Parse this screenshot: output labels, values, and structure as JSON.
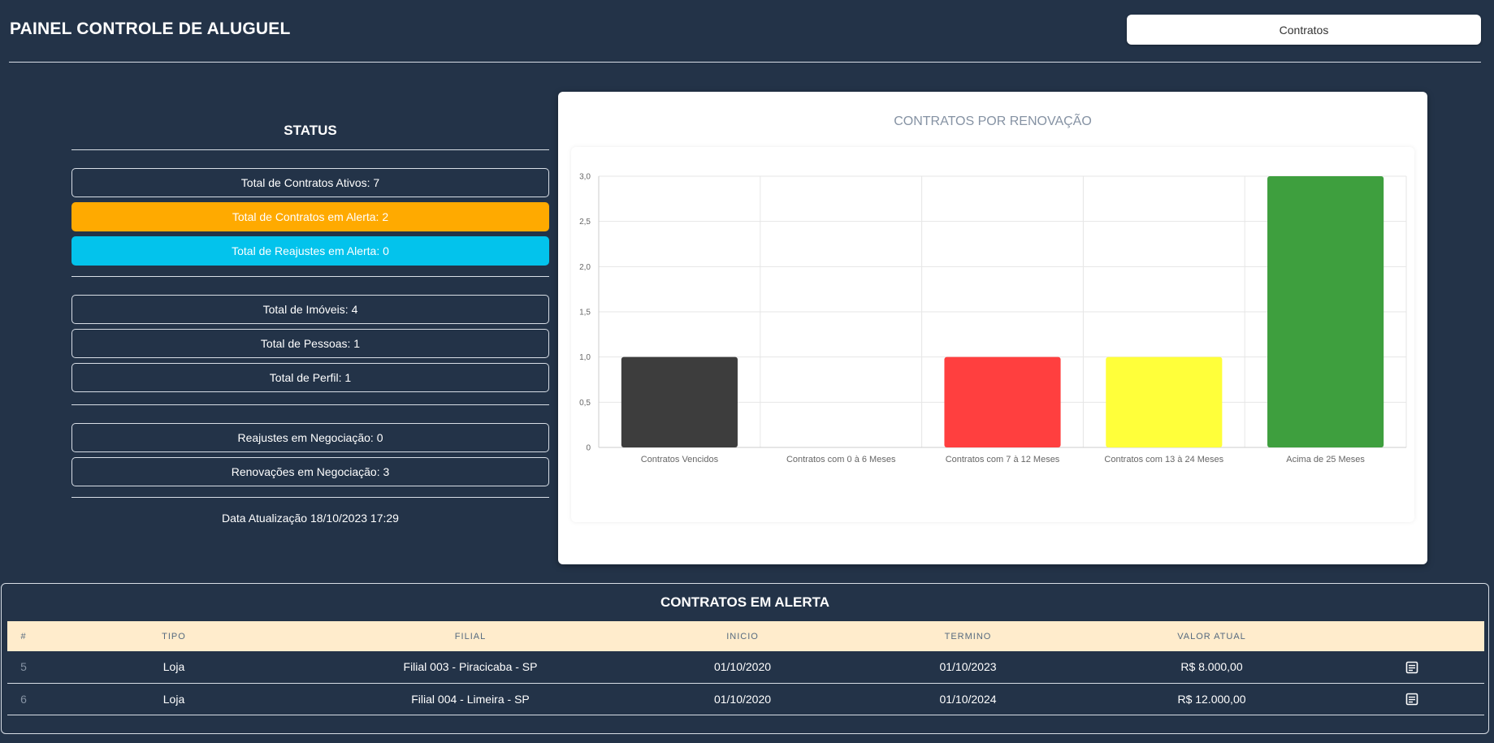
{
  "header": {
    "title": "PAINEL CONTROLE DE ALUGUEL",
    "contracts_button": "Contratos"
  },
  "status": {
    "title": "STATUS",
    "group1": [
      "Total de Contratos Ativos: 7",
      "Total de Contratos em Alerta: 2",
      "Total de Reajustes em Alerta: 0"
    ],
    "group2": [
      "Total de Imóveis: 4",
      "Total de Pessoas: 1",
      "Total de Perfil: 1"
    ],
    "group3": [
      "Reajustes em Negociação: 0",
      "Renovações em Negociação: 3"
    ],
    "update_date": "Data Atualização 18/10/2023 17:29"
  },
  "chart_data": {
    "type": "bar",
    "title": "CONTRATOS POR RENOVAÇÃO",
    "categories": [
      "Contratos Vencidos",
      "Contratos com 0 à 6 Meses",
      "Contratos com 7 à 12 Meses",
      "Contratos com 13 à 24 Meses",
      "Acima de 25 Meses"
    ],
    "values": [
      1,
      0,
      1,
      1,
      3
    ],
    "colors": [
      "#3d3d3d",
      "#ffffff",
      "#ff3f3f",
      "#ffff3a",
      "#3e9f3e"
    ],
    "yticks": [
      "0",
      "0,5",
      "1,0",
      "1,5",
      "2,0",
      "2,5",
      "3,0"
    ],
    "ylim": [
      0,
      3
    ],
    "grid": true
  },
  "alert_table": {
    "title": "CONTRATOS EM ALERTA",
    "columns": [
      "#",
      "TIPO",
      "FILIAL",
      "INICIO",
      "TERMINO",
      "VALOR ATUAL",
      ""
    ],
    "rows": [
      {
        "id": "5",
        "tipo": "Loja",
        "filial": "Filial 003 - Piracicaba - SP",
        "inicio": "01/10/2020",
        "termino": "01/10/2023",
        "valor": "R$ 8.000,00",
        "action_icon": "document-icon"
      },
      {
        "id": "6",
        "tipo": "Loja",
        "filial": "Filial 004 - Limeira - SP",
        "inicio": "01/10/2020",
        "termino": "01/10/2024",
        "valor": "R$ 12.000,00",
        "action_icon": "document-icon"
      }
    ]
  }
}
